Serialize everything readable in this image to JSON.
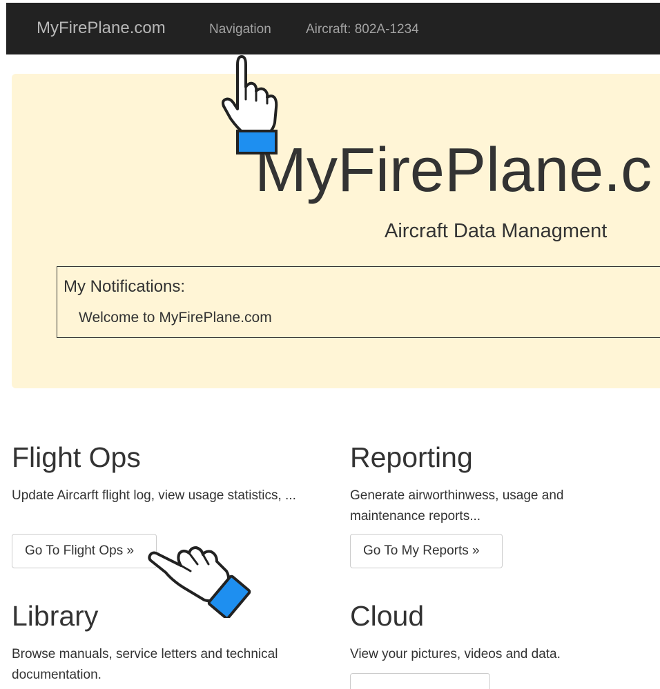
{
  "navbar": {
    "brand": "MyFirePlane.com",
    "links": [
      "Navigation",
      "Aircraft: 802A-1234"
    ]
  },
  "jumbotron": {
    "title": "MyFirePlane.c",
    "subtitle": "Aircraft Data Managment",
    "notifications": {
      "title": "My Notifications:",
      "message": "Welcome to MyFirePlane.com"
    }
  },
  "features": {
    "flight_ops": {
      "title": "Flight Ops",
      "description": "Update Aircarft flight log, view usage statistics, ...",
      "button": "Go To Flight Ops »"
    },
    "reporting": {
      "title": "Reporting",
      "description": "Generate airworthinwess, usage and maintenance reports...",
      "button": "Go To My Reports »"
    },
    "library": {
      "title": "Library",
      "description": "Browse manuals, service letters and technical documentation."
    },
    "cloud": {
      "title": "Cloud",
      "description": "View your pictures, videos and data."
    }
  },
  "colors": {
    "navbar_bg": "#222222",
    "jumbotron_bg": "#fff5d6",
    "cursor_cuff": "#1e8ff0"
  },
  "icons": [
    "pointing-hand-cursor-icon",
    "pointing-hand-cursor-icon"
  ]
}
